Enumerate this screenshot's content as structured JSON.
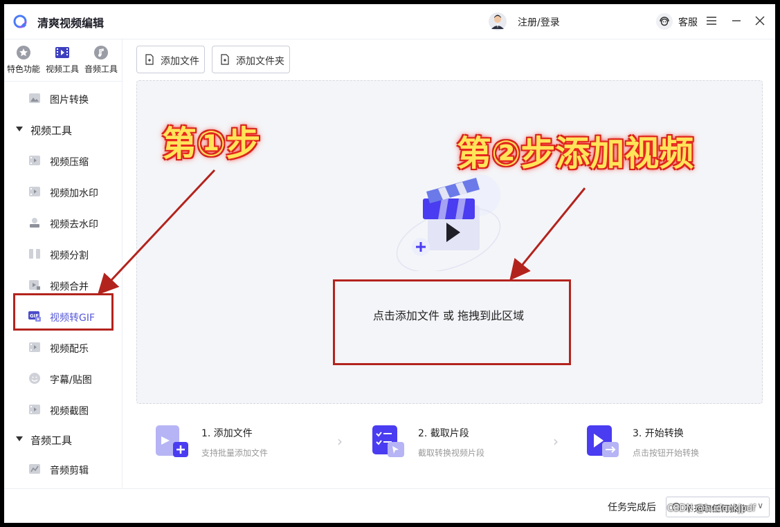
{
  "app": {
    "title": "清爽视频编辑"
  },
  "header": {
    "login_label": "注册/登录",
    "service_label": "客服"
  },
  "topnav": [
    {
      "label": "特色功能",
      "icon": "star-icon"
    },
    {
      "label": "视频工具",
      "icon": "video-tool-icon",
      "active": true
    },
    {
      "label": "音频工具",
      "icon": "audio-tool-icon"
    }
  ],
  "sidebar": {
    "image_convert": "图片转换",
    "video_group": "视频工具",
    "video_items": [
      "视频压缩",
      "视频加水印",
      "视频去水印",
      "视频分割",
      "视频合并",
      "视频转GIF",
      "视频配乐",
      "字幕/贴图",
      "视频截图"
    ],
    "active_item": "视频转GIF",
    "audio_group": "音频工具",
    "audio_items": [
      "音频剪辑"
    ]
  },
  "toolbar": {
    "add_file": "添加文件",
    "add_folder": "添加文件夹"
  },
  "dropzone": {
    "text": "点击添加文件 或 拖拽到此区域"
  },
  "steps": [
    {
      "title": "1. 添加文件",
      "desc": "支持批量添加文件"
    },
    {
      "title": "2. 截取片段",
      "desc": "截取转换视频片段"
    },
    {
      "title": "3. 开始转换",
      "desc": "点击按钮开始转换"
    }
  ],
  "footer": {
    "task_label": "任务完成后",
    "task_option": "不采取任何操作"
  },
  "annotations": {
    "step1": "第①步",
    "step2": "第②步添加视频"
  },
  "watermark": "CSDN @hudunkjpdf",
  "colors": {
    "accent": "#5457d8",
    "annotation_red": "#b3231d",
    "annotation_yellow": "#ffe45a"
  }
}
